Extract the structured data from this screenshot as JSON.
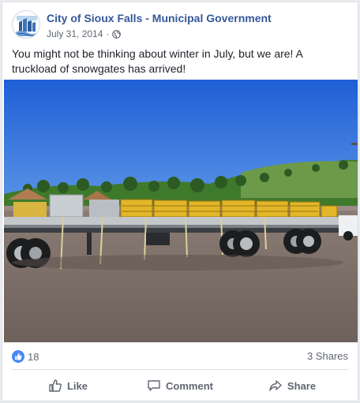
{
  "post": {
    "page_name": "City of Sioux Falls - Municipal Government",
    "date": "July 31, 2014",
    "separator": "·",
    "privacy_icon": "globe-icon",
    "text": "You might not be thinking about winter in July, but we are! A truckload of snowgates has arrived!"
  },
  "stats": {
    "like_count": "18",
    "shares": "3 Shares"
  },
  "actions": {
    "like": "Like",
    "comment": "Comment",
    "share": "Share"
  },
  "colors": {
    "link": "#365899",
    "like_badge": "#4a86f7",
    "muted": "#606770"
  }
}
